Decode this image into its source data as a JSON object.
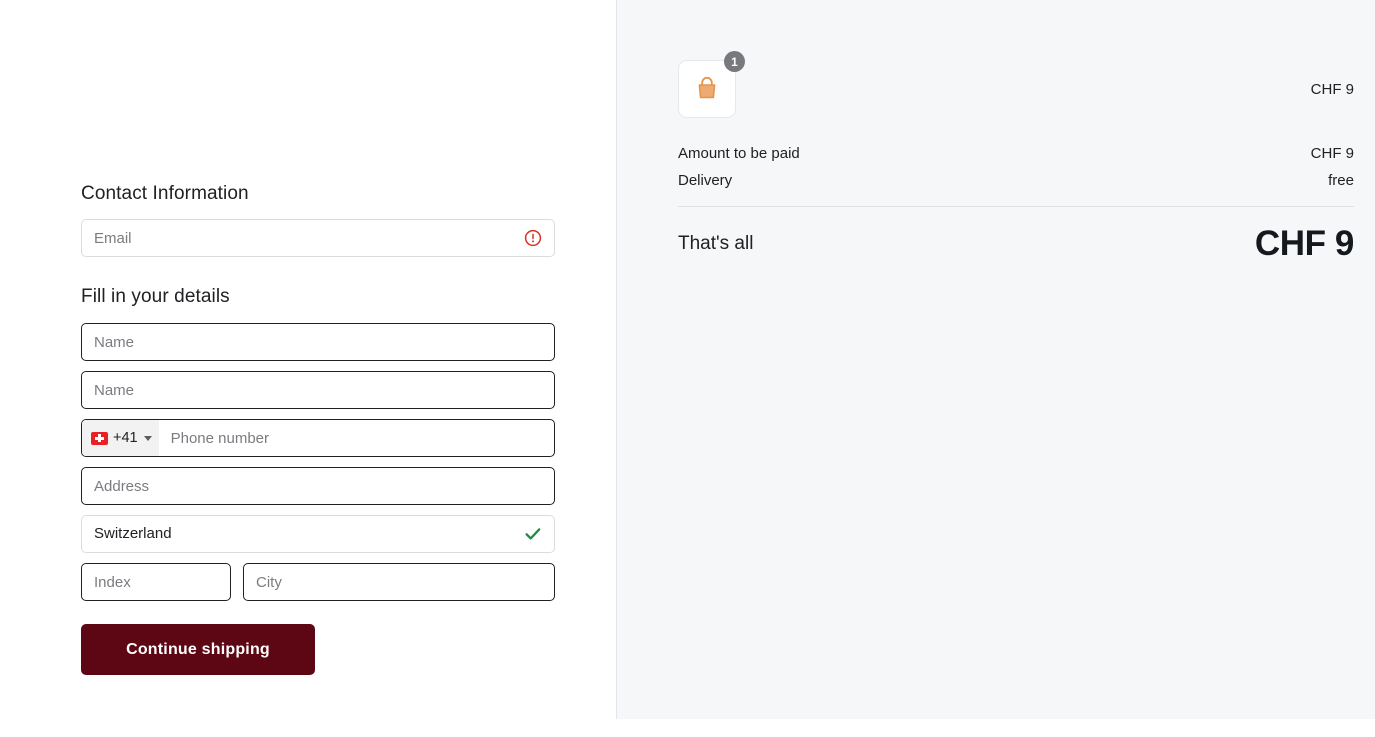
{
  "contact": {
    "title": "Contact Information",
    "email_placeholder": "Email",
    "email_value": "",
    "email_status_icon": "error-circle-icon"
  },
  "details": {
    "title": "Fill in your details",
    "first_name_placeholder": "Name",
    "first_name_value": "",
    "last_name_placeholder": "Name",
    "last_name_value": "",
    "phone": {
      "flag_icon": "swiss-flag-icon",
      "dial_code": "+41",
      "dropdown_icon": "chevron-down-icon",
      "placeholder": "Phone number",
      "value": ""
    },
    "address_placeholder": "Address",
    "address_value": "",
    "country_value": "Switzerland",
    "country_status_icon": "check-icon",
    "index_placeholder": "Index",
    "index_value": "",
    "city_placeholder": "City",
    "city_value": ""
  },
  "submit": {
    "label": "Continue shipping"
  },
  "summary": {
    "item": {
      "thumbnail_icon": "shopping-bag-icon",
      "quantity": "1",
      "price": "CHF 9"
    },
    "rows": [
      {
        "label": "Amount to be paid",
        "value": "CHF 9"
      },
      {
        "label": "Delivery",
        "value": "free"
      }
    ],
    "grand_total": {
      "label": "That's all",
      "value": "CHF 9"
    }
  },
  "colors": {
    "accent_button": "#5c0713",
    "error": "#d93025",
    "success": "#1e8e3e",
    "flag_red": "#eb2027",
    "bag_orange": "#e8934a",
    "panel_bg": "#f6f7f9"
  }
}
